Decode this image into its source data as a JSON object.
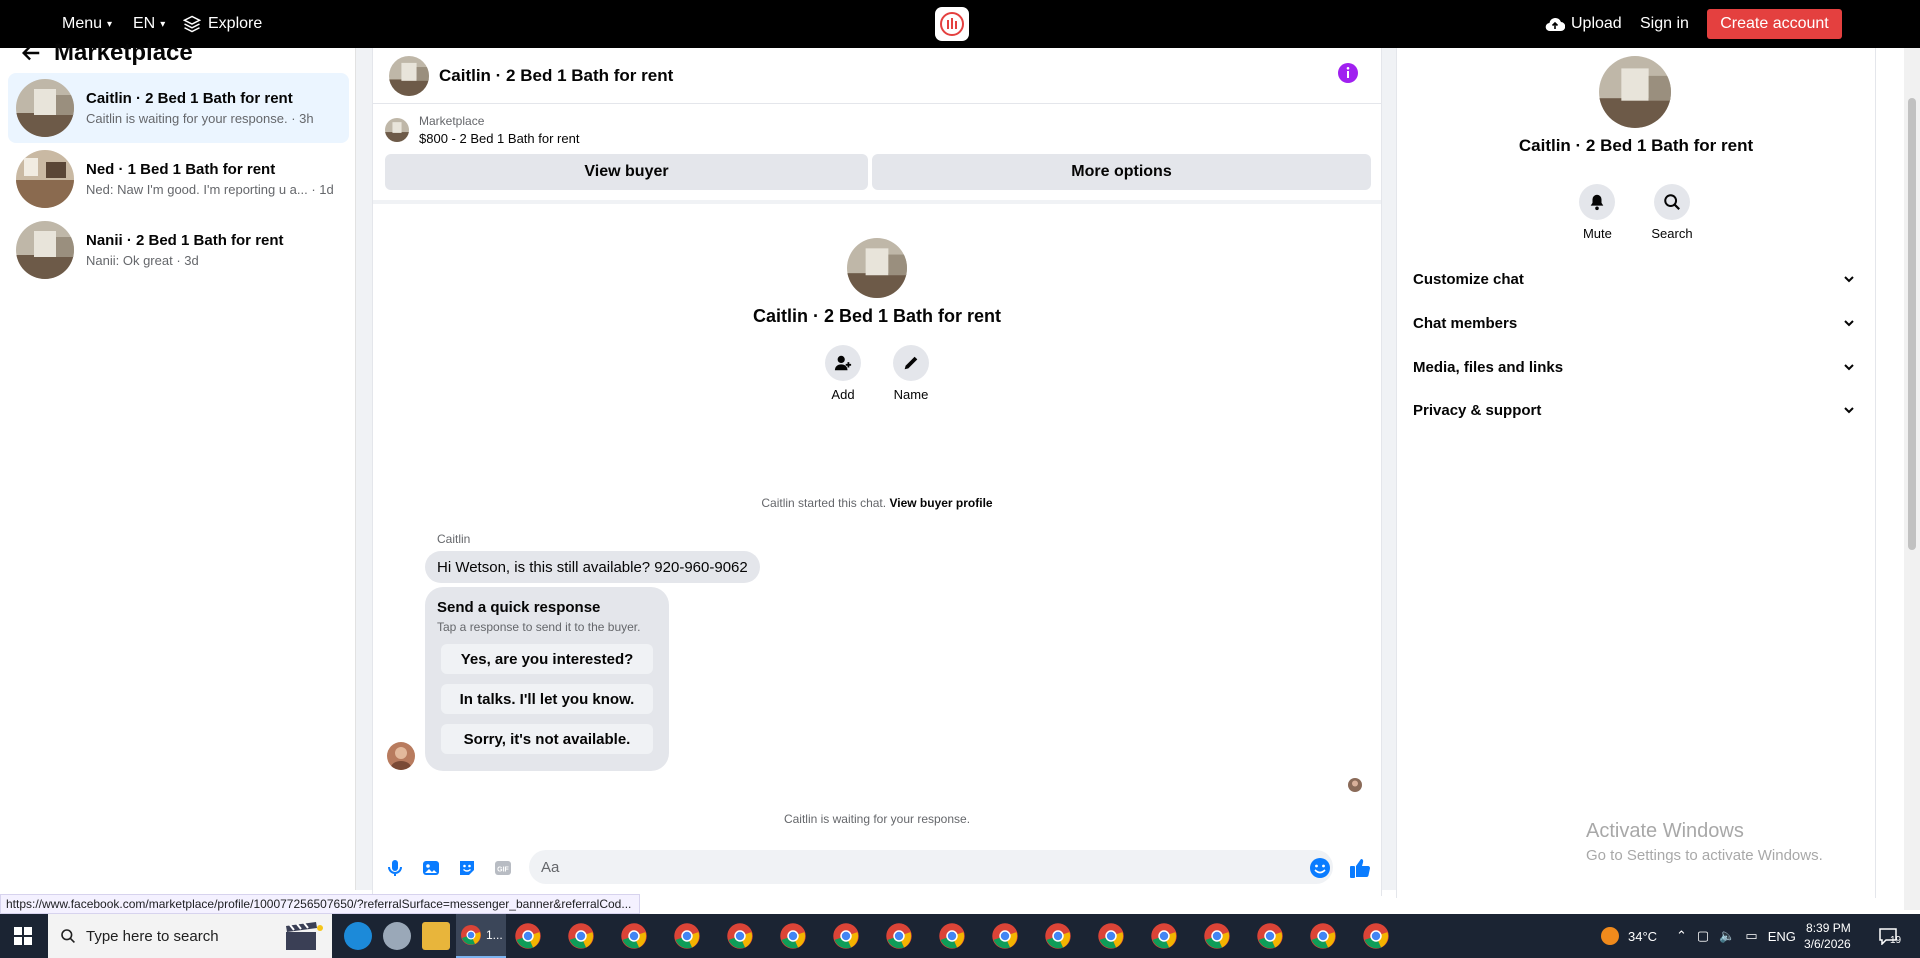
{
  "topbar": {
    "menu_label": "Menu",
    "lang_label": "EN",
    "explore_label": "Explore",
    "upload_label": "Upload",
    "signin_label": "Sign in",
    "create_label": "Create account",
    "brand_color": "#e4403f"
  },
  "left": {
    "title": "Marketplace",
    "conversations": [
      {
        "title": "Caitlin · 2 Bed 1 Bath for rent",
        "subtitle": "Caitlin is waiting for your response. · 3h"
      },
      {
        "title": "Ned · 1 Bed 1 Bath for rent",
        "subtitle": "Ned: Naw I'm good. I'm reporting u a... · 1d"
      },
      {
        "title": "Nanii · 2 Bed 1 Bath for rent",
        "subtitle": "Nanii: Ok great · 3d"
      }
    ]
  },
  "chat": {
    "title": "Caitlin · 2 Bed 1 Bath for rent",
    "listing_source": "Marketplace",
    "listing_price": "$800 - 2 Bed 1 Bath for rent",
    "view_buyer_label": "View buyer",
    "more_options_label": "More options",
    "intro_title": "Caitlin · 2 Bed 1 Bath for rent",
    "add_label": "Add",
    "name_label": "Name",
    "started_text": "Caitlin started this chat.",
    "view_profile_label": "View buyer profile",
    "sender_name": "Caitlin",
    "message": "Hi Wetson, is this still available? 920-960-9062",
    "quick_title": "Send a quick response",
    "quick_subtitle": "Tap a response to send it to the buyer.",
    "quick_responses": [
      "Yes, are you interested?",
      "In talks. I'll let you know.",
      "Sorry, it's not available."
    ],
    "waiting_text": "Caitlin is waiting for your response.",
    "composer_placeholder": "Aa",
    "accent_color": "#0a7cff",
    "info_color": "#a020f0"
  },
  "right": {
    "title": "Caitlin · 2 Bed 1 Bath for rent",
    "mute_label": "Mute",
    "search_label": "Search",
    "sections": [
      "Customize chat",
      "Chat members",
      "Media, files and links",
      "Privacy & support"
    ]
  },
  "watermark": {
    "line1": "Activate Windows",
    "line2": "Go to Settings to activate Windows."
  },
  "status_url": "https://www.facebook.com/marketplace/profile/100077256507650/?referralSurface=messenger_banner&referralCod...",
  "taskbar": {
    "search_placeholder": "Type here to search",
    "temperature": "34°C",
    "language": "ENG",
    "time": "8:39 PM",
    "date": "3/6/2026",
    "notification_count": "19",
    "active_app_label": "1..."
  }
}
